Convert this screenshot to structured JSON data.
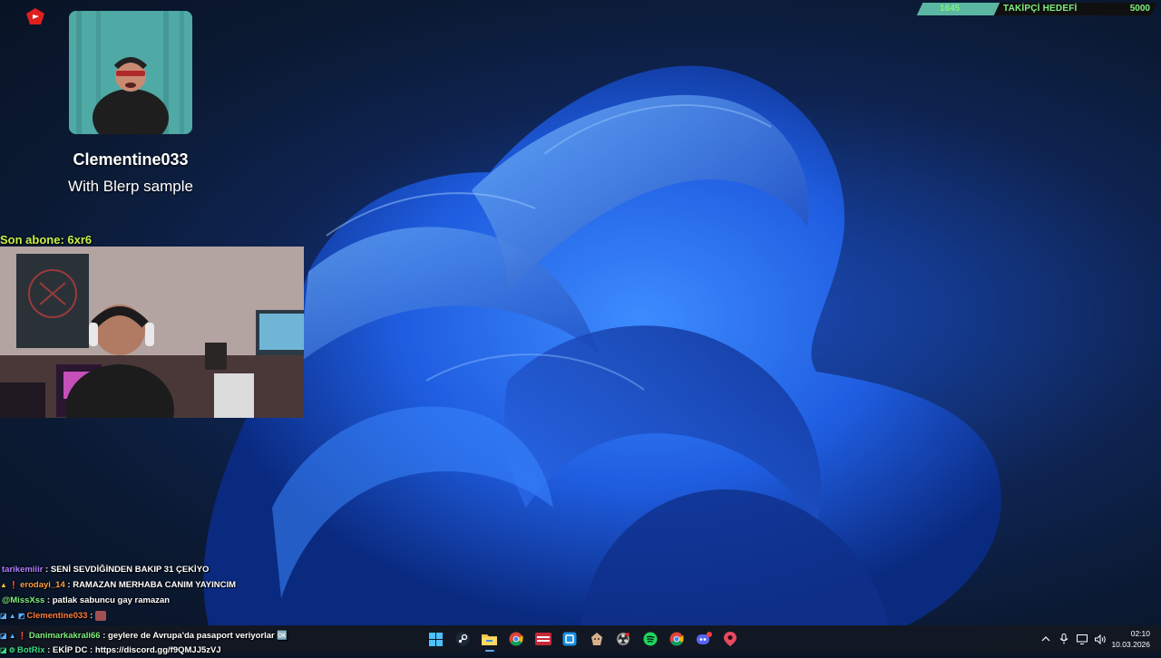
{
  "desktop": {
    "wallpaper": "windows-11-bloom"
  },
  "blerp": {
    "username": "Clementine033",
    "subtitle": "With Blerp sample"
  },
  "last_sub": {
    "label": "Son abone:",
    "value": "6xr6"
  },
  "follower_goal": {
    "current": "1645",
    "label": "TAKİPÇİ HEDEFİ",
    "target": "5000",
    "progress": 0.329
  },
  "chat": [
    {
      "user": "tarikemiiir",
      "user_color": "#b07dff",
      "message": " : SENİ SEVDİĞİNDEN BAKIP 31 ÇEKİYO",
      "badges": ""
    },
    {
      "user": "erodayi_14",
      "user_color": "#ff9d3b",
      "message": " : RAMAZAN MERHABA CANIM YAYINCIM",
      "badges": "▲ ❗"
    },
    {
      "user": "@MissXss",
      "user_color": "#7ff07f",
      "message": " : patlak sabuncu gay ramazan",
      "badges": ""
    },
    {
      "user": "Clementine033",
      "user_color": "#ff7b3b",
      "message": " : ",
      "badges": "◪ ▲ ◩",
      "emote": true
    },
    {
      "user": "Danimarkakrali66",
      "user_color": "#7ff07f",
      "message": " : geylere de Avrupa'da pasaport veriyorlar 🆗",
      "badges": "◪ ▲ ❗"
    },
    {
      "user": "BotRix",
      "user_color": "#3bdc8a",
      "message": " : EKİP DC : https://discord.gg/f9QMJJ5zVJ",
      "badges": "◪ ⚙"
    }
  ],
  "taskbar": {
    "apps": [
      {
        "name": "start-icon",
        "active": false
      },
      {
        "name": "steam-icon",
        "active": false
      },
      {
        "name": "file-explorer-icon",
        "active": true
      },
      {
        "name": "chrome-icon",
        "active": false
      },
      {
        "name": "voicemod-icon",
        "active": false
      },
      {
        "name": "snipping-tool-icon",
        "active": false
      },
      {
        "name": "game-app-icon",
        "active": false
      },
      {
        "name": "obs-icon",
        "active": false
      },
      {
        "name": "spotify-icon",
        "active": false
      },
      {
        "name": "chrome-profile-icon",
        "active": false
      },
      {
        "name": "discord-icon",
        "active": false
      },
      {
        "name": "riot-client-icon",
        "active": false
      }
    ],
    "tray": {
      "time": "02:10",
      "date": "10.03.2026"
    }
  },
  "colors": {
    "goal_text": "#7ff07f",
    "goal_fill": "#5bb6a2",
    "last_sub": "#c8f04a",
    "taskbar": "#141822"
  }
}
